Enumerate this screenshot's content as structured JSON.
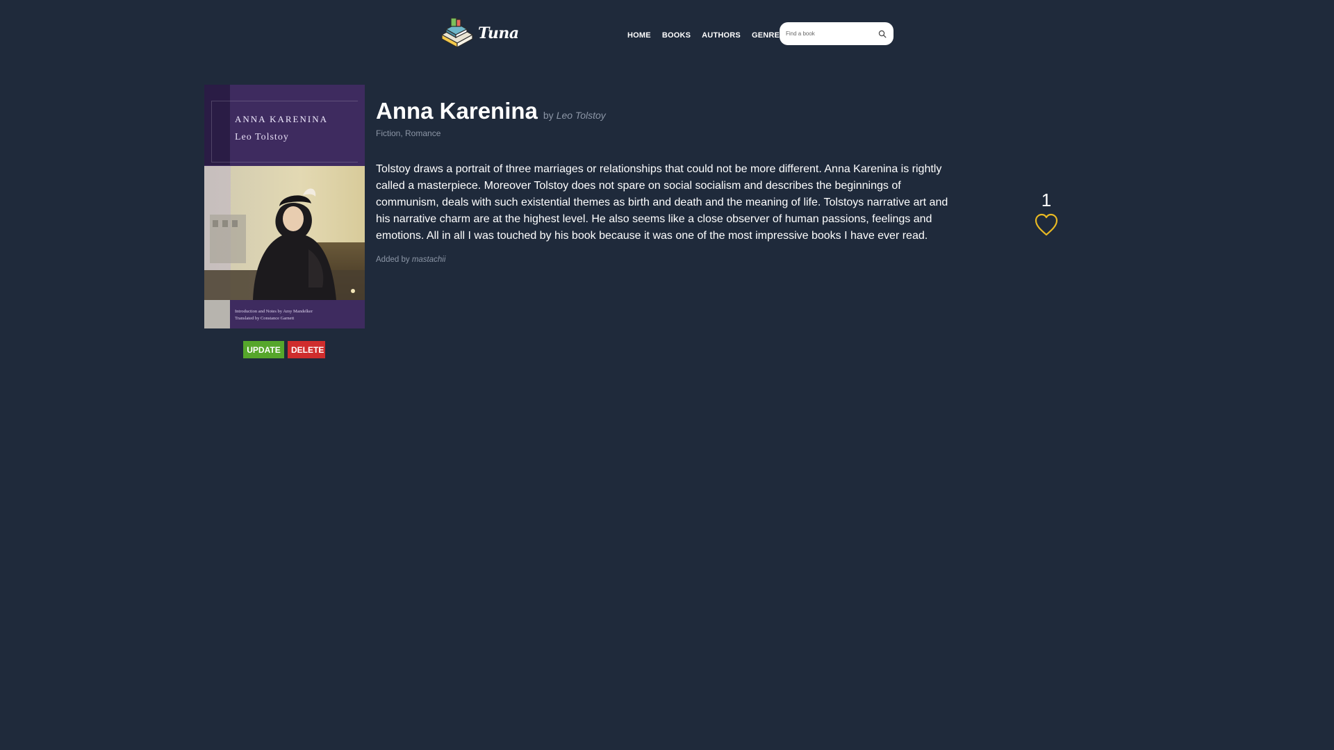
{
  "brand": {
    "name": "Tuna"
  },
  "nav": [
    {
      "label": "HOME"
    },
    {
      "label": "BOOKS"
    },
    {
      "label": "AUTHORS"
    },
    {
      "label": "GENRES"
    }
  ],
  "search": {
    "placeholder": "Find a book",
    "icon": "search-icon"
  },
  "cover": {
    "title": "ANNA KARENINA",
    "author": "Leo Tolstoy",
    "notes_line1": "Introduction and Notes by Amy Mandelker",
    "notes_line2": "Translated by Constance Garnett",
    "colors": {
      "background": "#3e2b5f",
      "spine": "#2a1c45"
    }
  },
  "book": {
    "title": "Anna Karenina",
    "by": "by",
    "author": "Leo Tolstoy",
    "genres": [
      "Fiction",
      "Romance"
    ],
    "genre_separator": ", ",
    "description": "Tolstoy draws a portrait of three marriages or relationships that could not be more different. Anna Karenina is rightly called a masterpiece. Moreover Tolstoy does not spare on social socialism and describes the beginnings of communism, deals with such existential themes as birth and death and the meaning of life. Tolstoys narrative art and his narrative charm are at the highest level. He also seems like a close observer of human passions, feelings and emotions. All in all I was touched by his book because it was one of the most impressive books I have ever read.",
    "added_by_label": "Added by",
    "added_by": "mastachii"
  },
  "actions": {
    "update_label": "UPDATE",
    "delete_label": "DELETE",
    "update_color": "#56a62b",
    "delete_color": "#cf2d2d"
  },
  "likes": {
    "count": "1",
    "icon": "heart-outline-icon",
    "color": "#e8b923"
  },
  "theme": {
    "background": "#1f2a3b",
    "muted_text": "#8c96a6"
  }
}
